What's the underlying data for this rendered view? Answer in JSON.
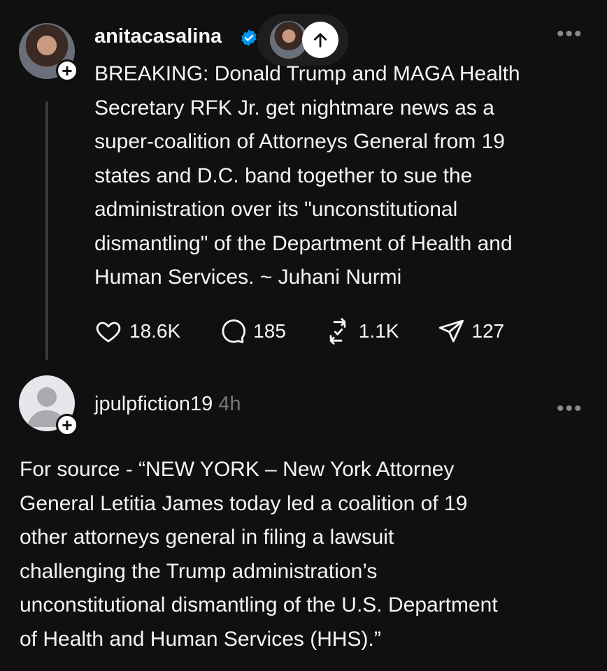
{
  "post1": {
    "username": "anitacasalina",
    "verified": true,
    "body": "BREAKING: Donald Trump and MAGA Health\nSecretary RFK Jr. get nightmare news as a\nsuper-coalition of Attorneys General from 19\nstates and D.C. band together to sue the\nadministration over its \"unconstitutional\ndismantling\" of the Department of Health and\nHuman Services. ~ Juhani Nurmi",
    "likes": "18.6K",
    "replies": "185",
    "reposts": "1.1K",
    "shares": "127",
    "more_icon": "more-dots-icon"
  },
  "post2": {
    "username": "jpulpfiction19",
    "timestamp": "4h",
    "body": "For source - “NEW YORK – New York Attorney\nGeneral Letitia James today led a coalition of 19\nother attorneys general in filing a lawsuit\nchallenging the Trump administration’s\nunconstitutional dismantling of the U.S. Department\nof Health and Human Services (HHS).”",
    "more_icon": "more-dots-icon"
  },
  "colors": {
    "background": "#101010",
    "text": "#f3f5f7",
    "muted": "#777777",
    "verified": "#0095f6"
  }
}
